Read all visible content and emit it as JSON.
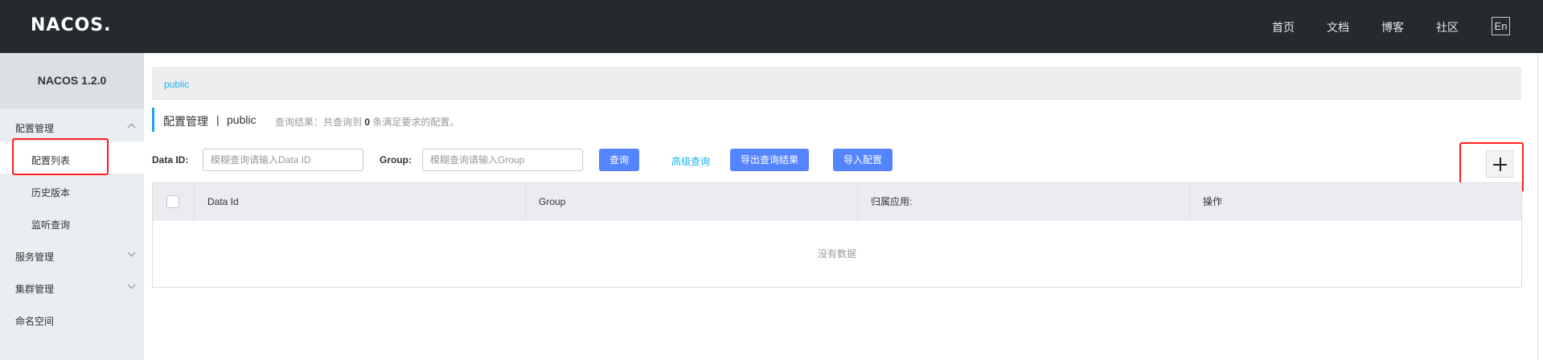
{
  "header": {
    "logo": "NACOS.",
    "nav": [
      "首页",
      "文档",
      "博客",
      "社区"
    ],
    "lang": "En"
  },
  "sidebar": {
    "title": "NACOS 1.2.0",
    "groups": [
      {
        "label": "配置管理",
        "expanded": true,
        "items": [
          "配置列表",
          "历史版本",
          "监听查询"
        ]
      },
      {
        "label": "服务管理",
        "expanded": false
      },
      {
        "label": "集群管理",
        "expanded": false
      },
      {
        "label": "命名空间"
      }
    ],
    "active_item": "配置列表"
  },
  "breadcrumb": {
    "namespace": "public"
  },
  "title": {
    "main": "配置管理",
    "separator": "|",
    "namespace": "public",
    "result_prefix": "查询结果：共查询到",
    "result_count": "0",
    "result_suffix": "条满足要求的配置。"
  },
  "search": {
    "data_id_label": "Data ID:",
    "data_id_placeholder": "模糊查询请输入Data ID",
    "group_label": "Group:",
    "group_placeholder": "模糊查询请输入Group",
    "query_button": "查询",
    "advanced_link": "高级查询",
    "export_button": "导出查询结果",
    "import_button": "导入配置"
  },
  "table": {
    "columns": [
      "Data Id",
      "Group",
      "归属应用:",
      "操作"
    ],
    "empty_text": "没有数据"
  },
  "colors": {
    "accent": "#5584ff",
    "link": "#1cb4f2",
    "highlight": "#ff1f1f",
    "topbar": "#252a2f"
  }
}
